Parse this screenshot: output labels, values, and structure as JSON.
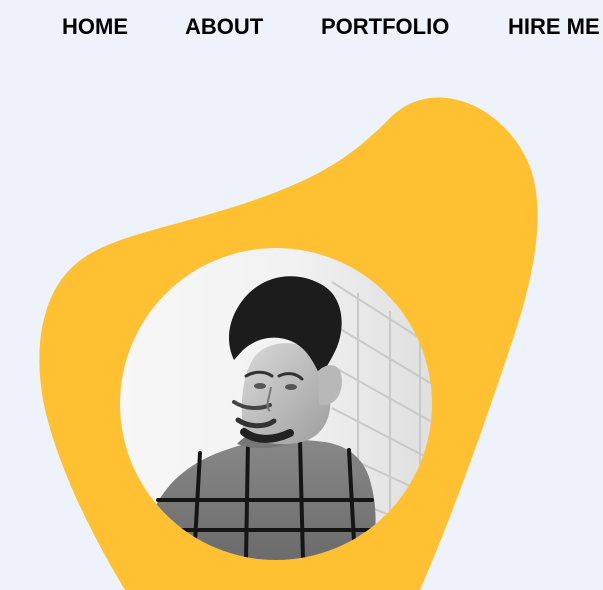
{
  "nav": {
    "items": [
      {
        "label": "HOME"
      },
      {
        "label": "ABOUT"
      },
      {
        "label": "PORTFOLIO"
      },
      {
        "label": "HIRE ME"
      }
    ]
  },
  "colors": {
    "background": "#eef3fb",
    "blob": "#ffc132",
    "text": "#000000"
  },
  "hero": {
    "photo_icon": "portrait-photo"
  }
}
